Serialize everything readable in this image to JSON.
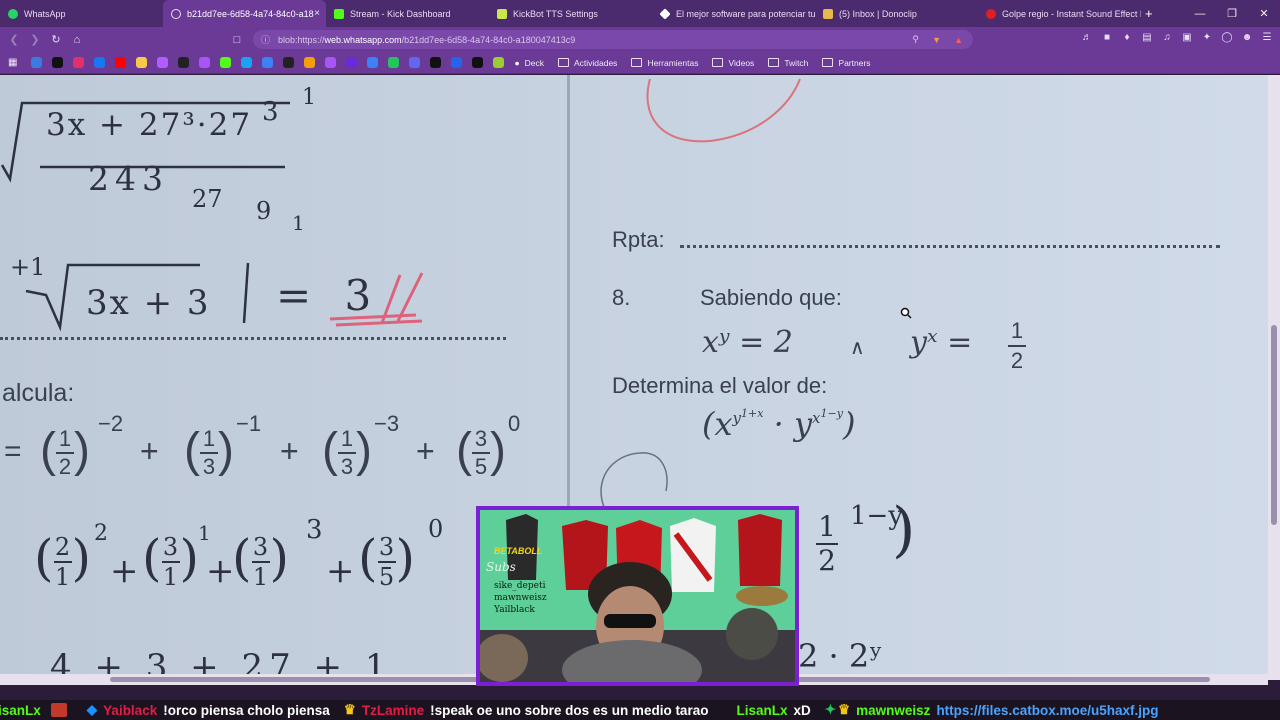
{
  "tabs": [
    {
      "label": "WhatsApp",
      "color": "#25d366",
      "active": false
    },
    {
      "label": "b21dd7ee-6d58-4a74-84c0-a18",
      "color": "#bfa8dc",
      "active": true
    },
    {
      "label": "Stream - Kick Dashboard",
      "color": "#53fc18",
      "active": false
    },
    {
      "label": "KickBot TTS Settings",
      "color": "#c9e84a",
      "active": false
    },
    {
      "label": "El mejor software para potenciar tu",
      "color": "#ffffff",
      "active": false
    },
    {
      "label": "(5) Inbox | Donoclip",
      "color": "#e8b84a",
      "active": false
    },
    {
      "label": "Golpe regio - Instant Sound Effect B",
      "color": "#e02020",
      "active": false
    }
  ],
  "tab_close": "×",
  "new_tab": "+",
  "window_controls": [
    "—",
    "❐",
    "✕"
  ],
  "address": {
    "prefix": "blob:https://",
    "host": "web.whatsapp.com",
    "path": "/b21dd7ee-6d58-4a74-84c0-a180047413c9"
  },
  "bookmarks": {
    "folders": [
      "Deck",
      "Actividades",
      "Herramientas",
      "Videos",
      "Twitch",
      "Partners"
    ],
    "icon_colors": [
      "#3a7be0",
      "#111111",
      "#e1306c",
      "#1877f2",
      "#ff0000",
      "#f7c948",
      "#b25cff",
      "#222222",
      "#a855f7",
      "#53fc18",
      "#1da1f2",
      "#3b82f6",
      "#222222",
      "#f59e0b",
      "#a855f7",
      "#6d28d9",
      "#3b82f6",
      "#22c55e",
      "#6366f1",
      "#111111",
      "#2563eb",
      "#111111",
      "#9acd32"
    ]
  },
  "document": {
    "left": {
      "root_top": "3x + 27³·27",
      "root_top_exp": "3",
      "root_top_exp2": "1",
      "root_denom": "243",
      "root_small1": "27",
      "root_small2": "9",
      "root_small3": "1",
      "root2_index": "+1",
      "root2_expr": "3x + 3",
      "root2_rhs": "= 3",
      "calcula": "alcula:",
      "row1_eq": "=",
      "frac_1_2": [
        "1",
        "2"
      ],
      "exp_m2": "−2",
      "frac_1_3a": [
        "1",
        "3"
      ],
      "exp_m1": "−1",
      "frac_1_3b": [
        "1",
        "3"
      ],
      "exp_m3": "−3",
      "frac_3_5": [
        "3",
        "5"
      ],
      "exp_0": "0",
      "plus": "+",
      "row2_f1": [
        "2",
        "1"
      ],
      "row2_e1": "2",
      "row2_f2": [
        "3",
        "1"
      ],
      "row2_e2": "1",
      "row2_f3": [
        "3",
        "1"
      ],
      "row2_e3": "3",
      "row2_f4": [
        "3",
        "5"
      ],
      "row2_e4": "0",
      "row3": "4 + 3 + 27 + 1"
    },
    "right": {
      "rpta": "Rpta:",
      "q_number": "8.",
      "sabiendo": "Sabiendo que:",
      "eq1": "xʸ = 2",
      "wedge": "∧",
      "eq2_lhs": "yˣ =",
      "eq2_frac": [
        "1",
        "2"
      ],
      "determina": "Determina el valor de:",
      "expr": "(x^{y^{1+x}} · y^{x^{1−y}})",
      "hw_frac": [
        "1",
        "2"
      ],
      "hw_exp": "1−y",
      "hw_bottom": "2 · 2ʸ"
    }
  },
  "webcam": {
    "overlay_title": "BETABOLL",
    "subs_label": "Subs",
    "subs": [
      "sike_depeti",
      "mawnweisz",
      "Yailblack"
    ]
  },
  "chat_ticker": [
    {
      "user": "isanLx",
      "user_color": "#53fc18",
      "message": "",
      "badge_color": "#c0392b"
    },
    {
      "user": "Yaiblack",
      "user_color": "#e11d48",
      "message": "!orco piensa cholo piensa",
      "badge_color": "#1e90ff"
    },
    {
      "user": "TzLamine",
      "user_color": "#e11d48",
      "message": "!speak oe uno sobre dos es un medio tarao",
      "badge_color": "#f5c518"
    },
    {
      "user": "LisanLx",
      "user_color": "#53fc18",
      "message": "xD",
      "badge_color": ""
    },
    {
      "user": "mawnweisz",
      "user_color": "#53fc18",
      "message": "https://files.catbox.moe/u5haxf.jpg",
      "badge_color": "#22c55e"
    }
  ]
}
